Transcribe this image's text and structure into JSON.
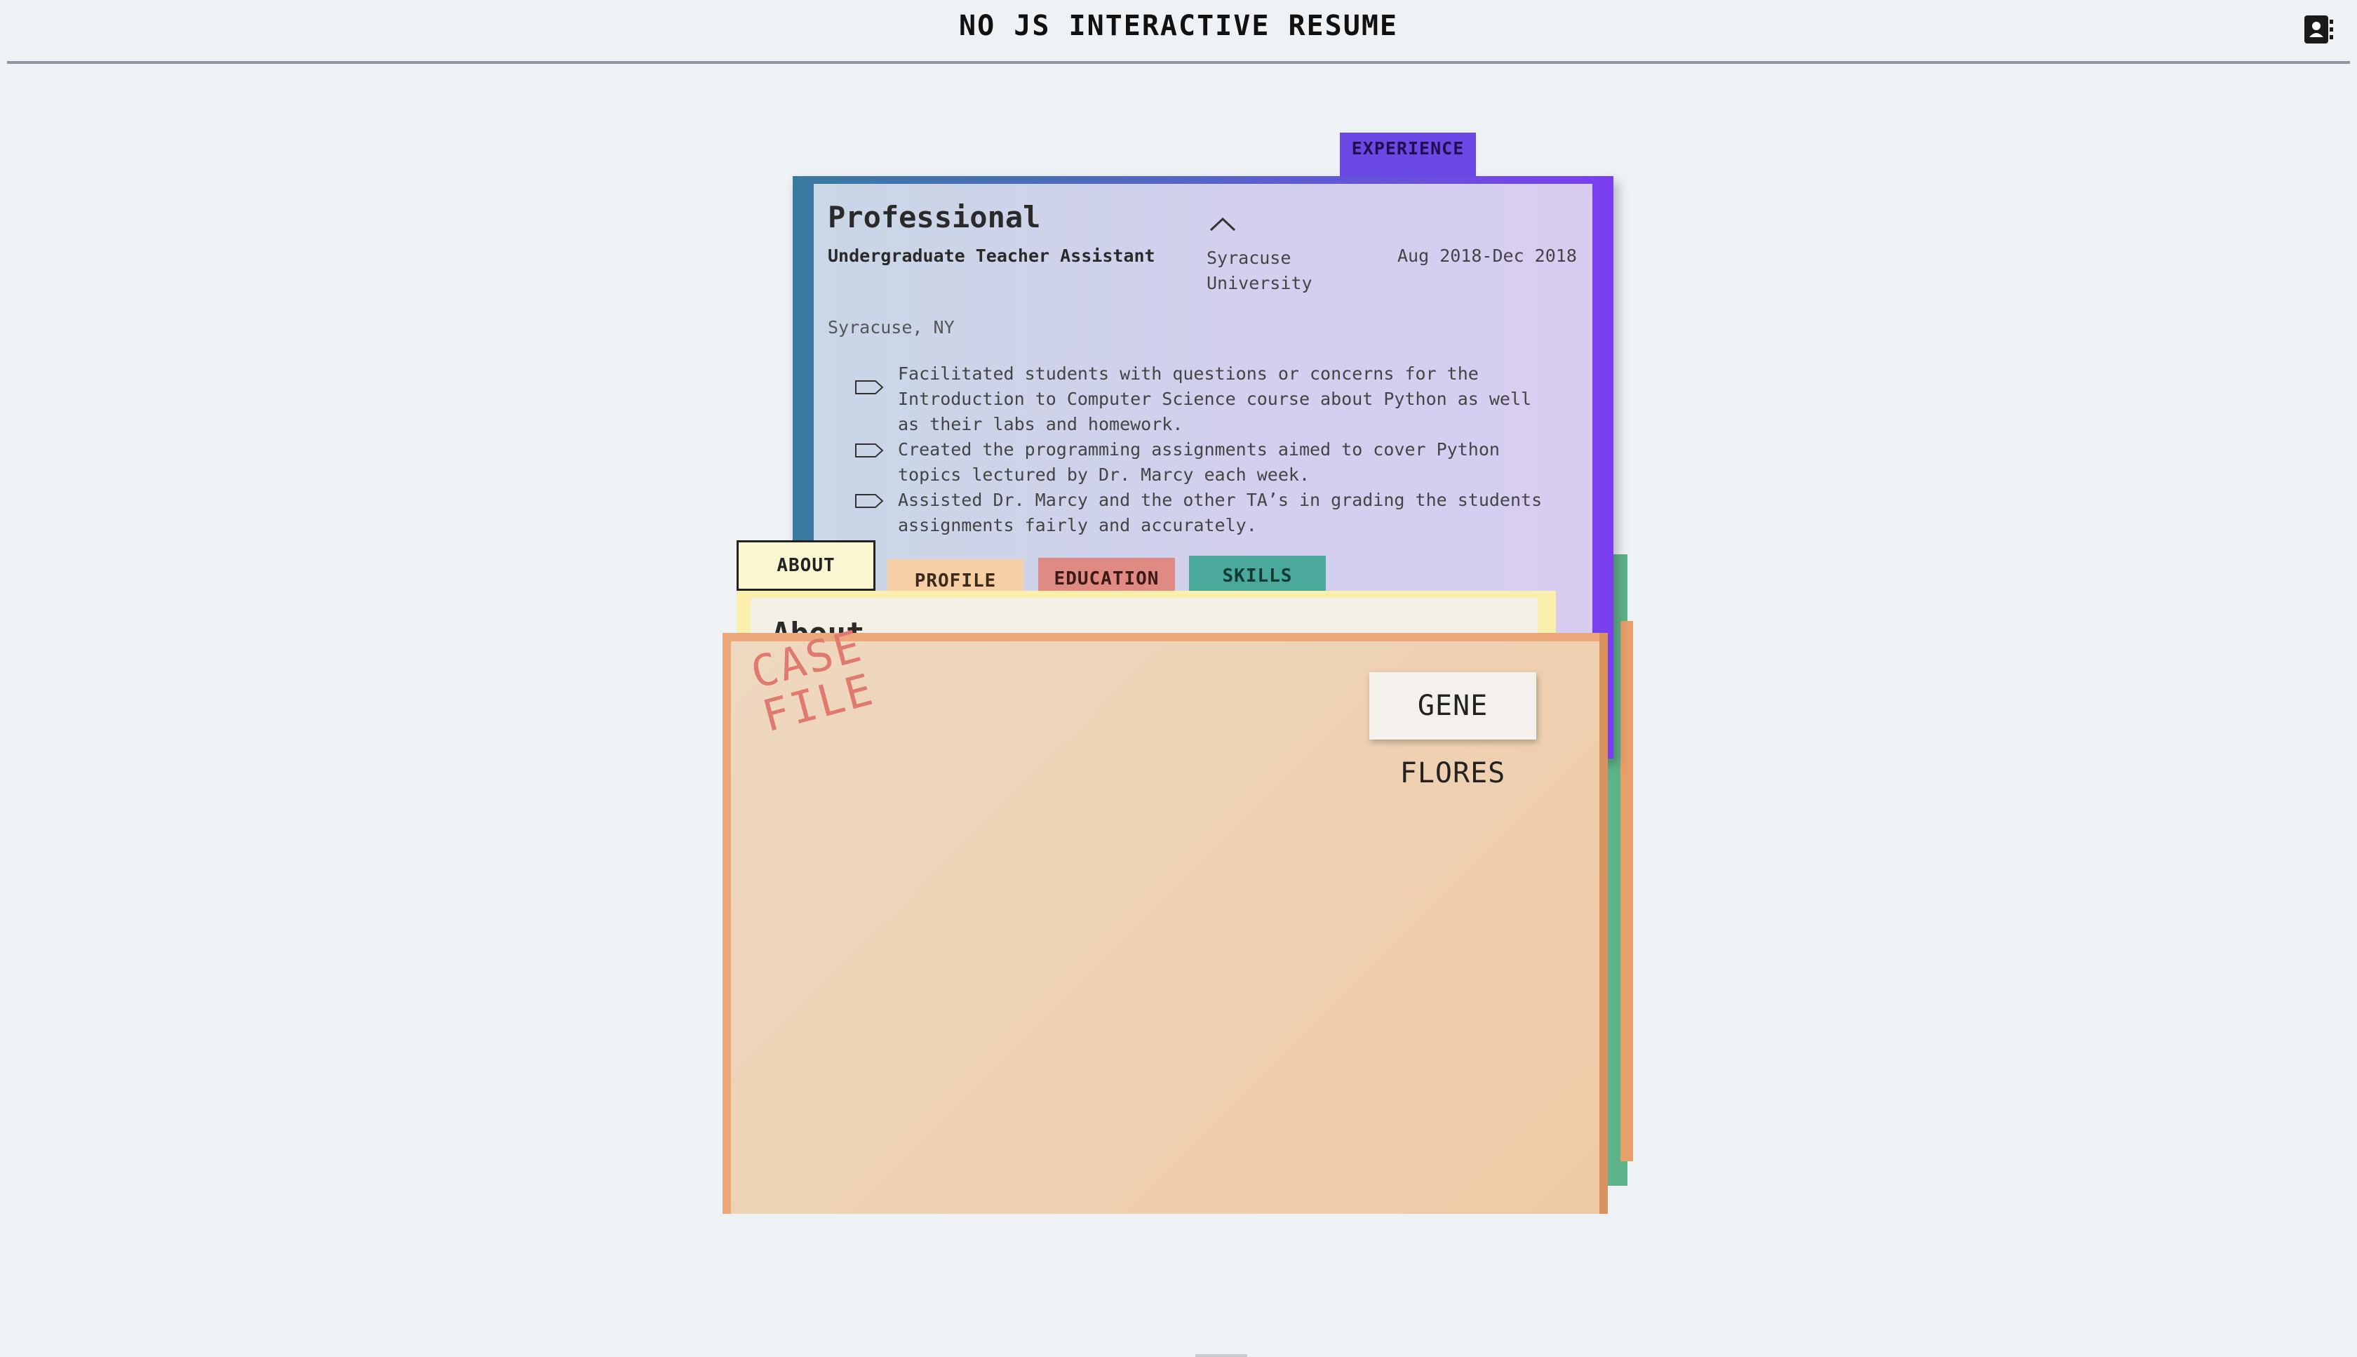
{
  "header": {
    "title": "NO JS INTERACTIVE RESUME",
    "contact_icon": "address-book-icon"
  },
  "experience": {
    "tab_label": "EXPERIENCE",
    "heading": "Professional",
    "role": "Undergraduate Teacher Assistant",
    "organization": "Syracuse University",
    "dates": "Aug 2018-Dec 2018",
    "location": "Syracuse, NY",
    "bullets": [
      "Facilitated students with questions or concerns for the Introduction to Computer Science course about Python as well as their labs and homework.",
      "Created the programming assignments aimed to cover Python topics lectured by Dr. Marcy each week.",
      "Assisted Dr. Marcy and the other TA’s in grading the students assignments fairly and accurately."
    ],
    "collapse_icon": "chevron-up-icon",
    "bullet_icon": "tag-icon"
  },
  "tabs": {
    "about": "ABOUT",
    "profile": "PROFILE",
    "education": "EDUCATION",
    "skills": "SKILLS"
  },
  "about": {
    "heading": "About"
  },
  "case_file": {
    "stamp": "CASE FILE",
    "name": "GENE FLORES"
  },
  "colors": {
    "background": "#eef2f5",
    "experience": "#6a48e3",
    "about": "#fbf7d3",
    "profile": "#f7cfa6",
    "education": "#df8a82",
    "skills": "#4aa99a",
    "case_file": "#eca77b",
    "stamp": "#e07a6e"
  }
}
